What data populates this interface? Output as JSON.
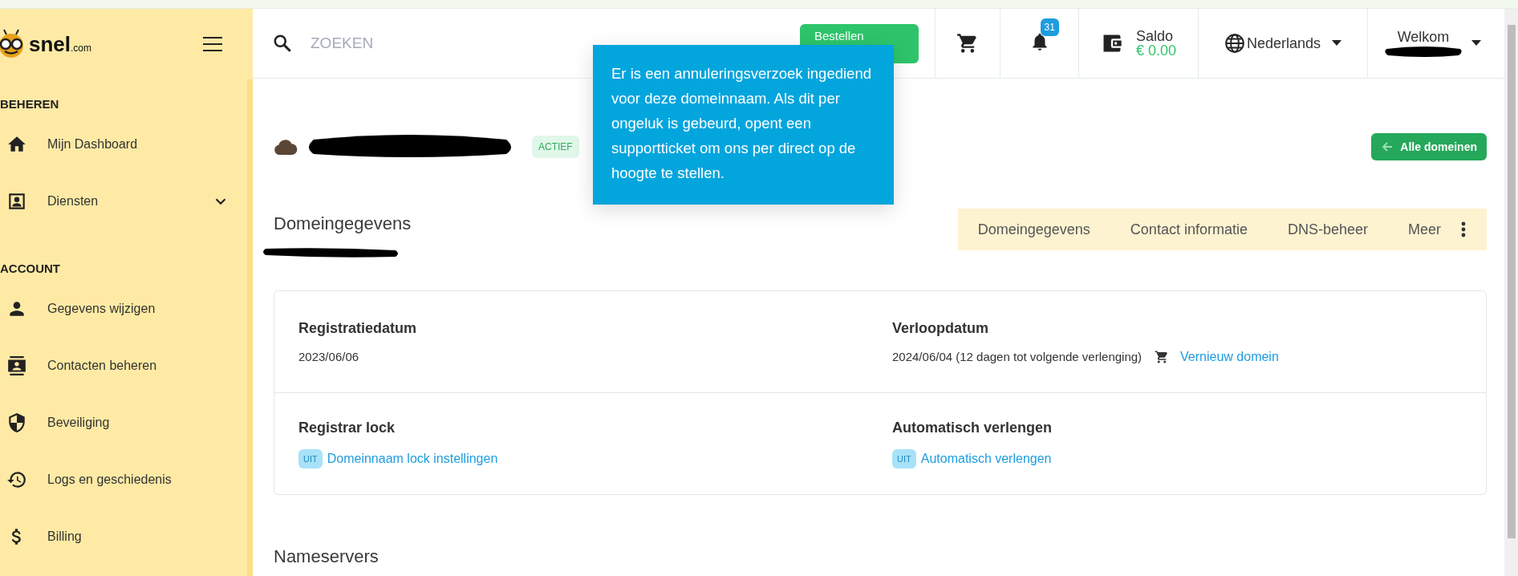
{
  "logo": {
    "text": "snel",
    "suffix": ".com"
  },
  "search": {
    "placeholder": "ZOEKEN"
  },
  "topbar": {
    "order_button": "Bestellen",
    "notifications": "31",
    "balance_label": "Saldo",
    "balance": "€ 0.00",
    "language": "Nederlands",
    "welcome": "Welkom"
  },
  "sidebar": {
    "sections": [
      {
        "title": "BEHEREN",
        "items": [
          {
            "label": "Mijn Dashboard",
            "kind": "link"
          },
          {
            "label": "Diensten",
            "kind": "submenu"
          }
        ]
      },
      {
        "title": "ACCOUNT",
        "items": [
          {
            "label": "Gegevens wijzigen",
            "kind": "link"
          },
          {
            "label": "Contacten beheren",
            "kind": "link"
          },
          {
            "label": "Beveiliging",
            "kind": "link"
          },
          {
            "label": "Logs en geschiedenis",
            "kind": "link"
          },
          {
            "label": "Billing",
            "kind": "link"
          }
        ]
      }
    ]
  },
  "tooltip": {
    "text": "Er is een annuleringsverzoek ingediend voor deze domeinnaam. Als dit per ongeluk is gebeurd, opent een supportticket om ons per direct op de hoogte te stellen."
  },
  "domain": {
    "status": "ACTIEF",
    "back_button": "Alle domeinen"
  },
  "section_title": "Domeingegevens",
  "tabs": [
    {
      "label": "Domeingegevens",
      "selected": false
    },
    {
      "label": "Contact informatie",
      "selected": false
    },
    {
      "label": "DNS-beheer",
      "selected": false
    },
    {
      "label": "Meer",
      "selected": false
    }
  ],
  "details": [
    {
      "label": "Registratiedatum",
      "value": "2023/06/06"
    },
    {
      "label": "Verloopdatum",
      "value": "2024/06/04 (12 dagen tot volgende verlenging)",
      "link": "Vernieuw domein"
    },
    {
      "label": "Registrar lock",
      "badge": "UIT",
      "link": "Domeinnaam lock instellingen"
    },
    {
      "label": "Automatisch verlengen",
      "badge": "UIT",
      "link": "Automatisch verlengen"
    }
  ],
  "nameservers_title": "Nameservers"
}
